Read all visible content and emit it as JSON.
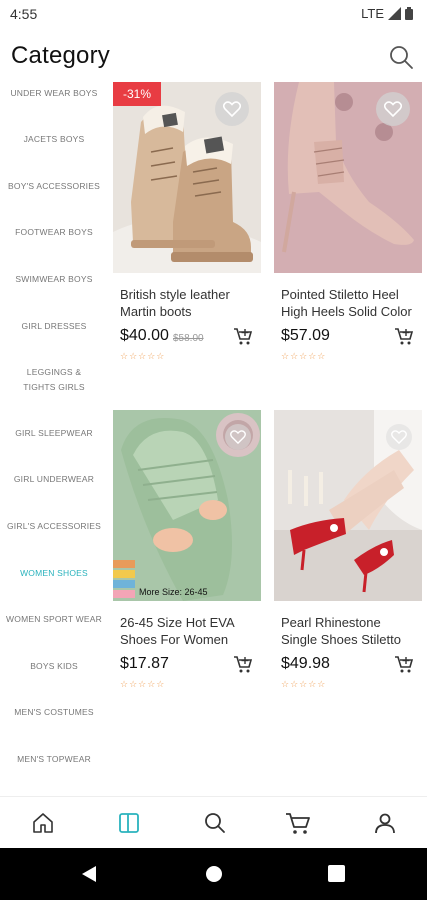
{
  "status": {
    "time": "4:55",
    "network": "LTE"
  },
  "header": {
    "title": "Category"
  },
  "categories": [
    {
      "label": "UNDER WEAR BOYS"
    },
    {
      "label": "JACETS BOYS"
    },
    {
      "label": "BOY'S ACCESSORIES"
    },
    {
      "label": "FOOTWEAR BOYS"
    },
    {
      "label": "SWIMWEAR BOYS"
    },
    {
      "label": "GIRL DRESSES"
    },
    {
      "label": "LEGGINGS & TIGHTS GIRLS"
    },
    {
      "label": "GIRL SLEEPWEAR"
    },
    {
      "label": "GIRL UNDERWEAR"
    },
    {
      "label": "GIRL'S ACCESSORIES"
    },
    {
      "label": "WOMEN SHOES",
      "active": true
    },
    {
      "label": "WOMEN SPORT WEAR"
    },
    {
      "label": "BOYS KIDS"
    },
    {
      "label": "MEN'S COSTUMES"
    },
    {
      "label": "MEN'S TOPWEAR"
    }
  ],
  "products": [
    {
      "name": "British style leather Martin boots",
      "price": "$40.00",
      "old_price": "$58.00",
      "badge": "-31%",
      "rating": "☆☆☆☆☆"
    },
    {
      "name": "Pointed Stiletto Heel High Heels Solid Color",
      "price": "$57.09",
      "rating": "☆☆☆☆☆"
    },
    {
      "name": "26-45 Size Hot EVA Shoes For Women",
      "price": "$17.87",
      "rating": "☆☆☆☆☆",
      "image_caption": "More Size: 26-45"
    },
    {
      "name": "Pearl Rhinestone Single Shoes Stiletto",
      "price": "$49.98",
      "rating": "☆☆☆☆☆"
    }
  ],
  "colors": {
    "accent": "#2ab3bd",
    "badge": "#e83c43",
    "stars": "#f0a35c"
  },
  "bottom_nav": [
    "home-icon",
    "category-icon",
    "search-icon",
    "cart-icon",
    "profile-icon"
  ]
}
